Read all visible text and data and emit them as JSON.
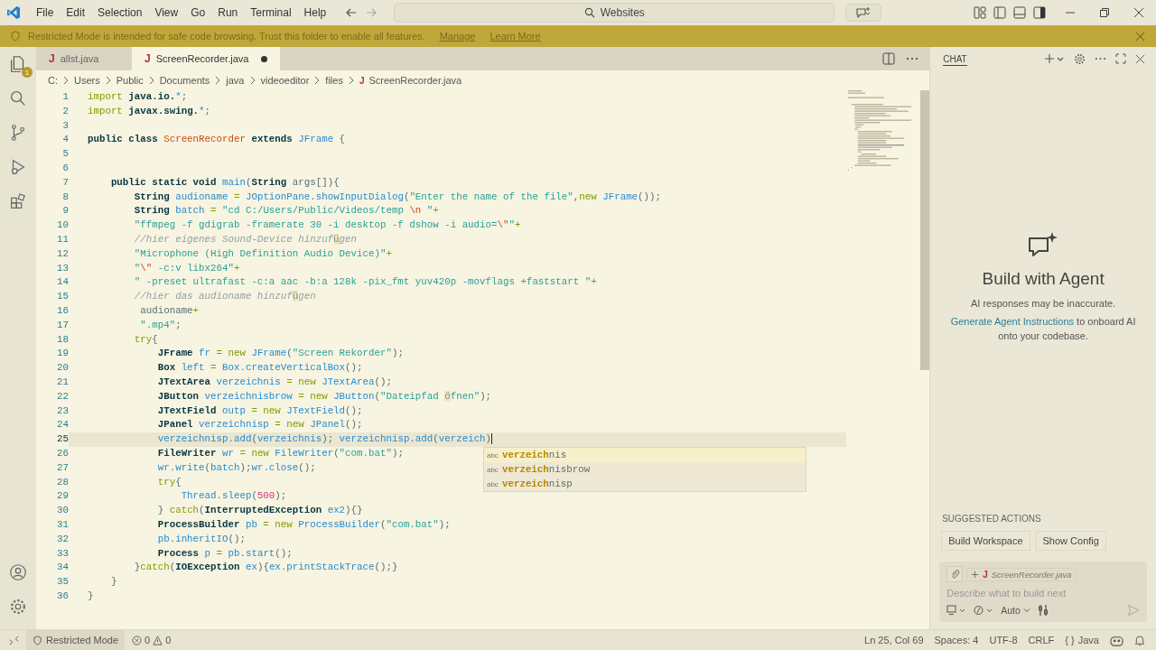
{
  "menu": [
    "File",
    "Edit",
    "Selection",
    "View",
    "Go",
    "Run",
    "Terminal",
    "Help"
  ],
  "search": {
    "value": "Websites"
  },
  "banner": {
    "text": "Restricted Mode is intended for safe code browsing. Trust this folder to enable all features.",
    "links": [
      "Manage",
      "Learn More"
    ]
  },
  "activity_bar": {
    "badge": "1"
  },
  "tabs": [
    {
      "label": "allst.java",
      "file_icon": "J",
      "selected": false,
      "modified": false
    },
    {
      "label": "ScreenRecorder.java",
      "file_icon": "J",
      "selected": true,
      "modified": true
    }
  ],
  "breadcrumb": {
    "parts": [
      "C:",
      "Users",
      "Public",
      "Documents",
      "java",
      "videoeditor",
      "files"
    ],
    "file": "ScreenRecorder.java",
    "file_icon": "J"
  },
  "code_lines": [
    {
      "number": "1",
      "current": false,
      "tokens": [
        {
          "kind": "keyword",
          "text": "import"
        },
        {
          "kind": "storage",
          "text": " java.io."
        },
        {
          "kind": "variable",
          "text": "*"
        },
        {
          "kind": "plain",
          "text": ";"
        }
      ]
    },
    {
      "number": "2",
      "current": false,
      "tokens": [
        {
          "kind": "keyword",
          "text": "import"
        },
        {
          "kind": "storage",
          "text": " javax.swing."
        },
        {
          "kind": "variable",
          "text": "*"
        },
        {
          "kind": "plain",
          "text": ";"
        }
      ]
    },
    {
      "number": "3",
      "current": false
    },
    {
      "number": "4",
      "current": false,
      "tokens": [
        {
          "kind": "storage",
          "text": "public class "
        },
        {
          "kind": "constant",
          "text": "ScreenRecorder"
        },
        {
          "kind": "storage",
          "text": " extends "
        },
        {
          "kind": "variable",
          "text": "JFrame"
        },
        {
          "kind": "plain",
          "text": " {"
        }
      ]
    },
    {
      "number": "5",
      "current": false
    },
    {
      "number": "6",
      "current": false
    },
    {
      "number": "7",
      "current": false,
      "tokens": [
        {
          "kind": "storage",
          "text": "    public static void "
        },
        {
          "kind": "variable",
          "text": "main"
        },
        {
          "kind": "plain",
          "text": "("
        },
        {
          "kind": "storage",
          "text": "String"
        },
        {
          "kind": "plain",
          "text": " args[]){"
        }
      ]
    },
    {
      "number": "8",
      "current": false,
      "tokens": [
        {
          "kind": "storage",
          "text": "        String "
        },
        {
          "kind": "variable",
          "text": "audioname"
        },
        {
          "kind": "keyword",
          "text": " = "
        },
        {
          "kind": "variable",
          "text": "JOptionPane.showInputDialog"
        },
        {
          "kind": "plain",
          "text": "("
        },
        {
          "kind": "string",
          "text": "\"Enter the name of the file\""
        },
        {
          "kind": "plain",
          "text": ","
        },
        {
          "kind": "keyword",
          "text": "new "
        },
        {
          "kind": "variable",
          "text": "JFrame"
        },
        {
          "kind": "plain",
          "text": "());"
        }
      ]
    },
    {
      "number": "9",
      "current": false,
      "tokens": [
        {
          "kind": "storage",
          "text": "        String "
        },
        {
          "kind": "variable",
          "text": "batch"
        },
        {
          "kind": "keyword",
          "text": " = "
        },
        {
          "kind": "string",
          "text": "\"cd C:/Users/Public/Videos/temp "
        },
        {
          "kind": "constant",
          "text": "\\n"
        },
        {
          "kind": "string",
          "text": " \""
        },
        {
          "kind": "keyword",
          "text": "+"
        }
      ]
    },
    {
      "number": "10",
      "current": false,
      "tokens": [
        {
          "kind": "string",
          "text": "        \"ffmpeg -f gdigrab -framerate 30 -i desktop -f dshow -i audio="
        },
        {
          "kind": "constant",
          "text": "\\\""
        },
        {
          "kind": "string",
          "text": "\""
        },
        {
          "kind": "keyword",
          "text": "+"
        }
      ]
    },
    {
      "number": "11",
      "current": false,
      "tokens": [
        {
          "kind": "comment",
          "text": "        //hier eigenes Sound-Device hinzuf"
        },
        {
          "kind": "unicode",
          "text": "ü"
        },
        {
          "kind": "comment",
          "text": "gen"
        }
      ]
    },
    {
      "number": "12",
      "current": false,
      "tokens": [
        {
          "kind": "string",
          "text": "        \"Microphone (High Definition Audio Device)\""
        },
        {
          "kind": "keyword",
          "text": "+"
        }
      ]
    },
    {
      "number": "13",
      "current": false,
      "tokens": [
        {
          "kind": "string",
          "text": "        \""
        },
        {
          "kind": "constant",
          "text": "\\\""
        },
        {
          "kind": "string",
          "text": " -c:v libx264\""
        },
        {
          "kind": "keyword",
          "text": "+"
        }
      ]
    },
    {
      "number": "14",
      "current": false,
      "tokens": [
        {
          "kind": "string",
          "text": "        \" -preset ultrafast -c:a aac -b:a 128k -pix_fmt yuv420p -movflags +faststart \""
        },
        {
          "kind": "keyword",
          "text": "+"
        }
      ]
    },
    {
      "number": "15",
      "current": false,
      "tokens": [
        {
          "kind": "comment",
          "text": "        //hier das audioname hinzuf"
        },
        {
          "kind": "unicode",
          "text": "ü"
        },
        {
          "kind": "comment",
          "text": "gen"
        }
      ]
    },
    {
      "number": "16",
      "current": false,
      "tokens": [
        {
          "kind": "plain",
          "text": "         audioname"
        },
        {
          "kind": "keyword",
          "text": "+"
        }
      ]
    },
    {
      "number": "17",
      "current": false,
      "tokens": [
        {
          "kind": "string",
          "text": "         \".mp4\""
        },
        {
          "kind": "plain",
          "text": ";"
        }
      ]
    },
    {
      "number": "18",
      "current": false,
      "tokens": [
        {
          "kind": "keyword",
          "text": "        try"
        },
        {
          "kind": "plain",
          "text": "{"
        }
      ]
    },
    {
      "number": "19",
      "current": false,
      "tokens": [
        {
          "kind": "storage",
          "text": "            JFrame "
        },
        {
          "kind": "variable",
          "text": "fr"
        },
        {
          "kind": "keyword",
          "text": " = new "
        },
        {
          "kind": "variable",
          "text": "JFrame"
        },
        {
          "kind": "plain",
          "text": "("
        },
        {
          "kind": "string",
          "text": "\"Screen Rekorder\""
        },
        {
          "kind": "plain",
          "text": ");"
        }
      ]
    },
    {
      "number": "20",
      "current": false,
      "tokens": [
        {
          "kind": "storage",
          "text": "            Box "
        },
        {
          "kind": "variable",
          "text": "left"
        },
        {
          "kind": "keyword",
          "text": " = "
        },
        {
          "kind": "variable",
          "text": "Box.createVerticalBox"
        },
        {
          "kind": "plain",
          "text": "();"
        }
      ]
    },
    {
      "number": "21",
      "current": false,
      "tokens": [
        {
          "kind": "storage",
          "text": "            JTextArea "
        },
        {
          "kind": "variable",
          "text": "verzeichnis"
        },
        {
          "kind": "keyword",
          "text": " = new "
        },
        {
          "kind": "variable",
          "text": "JTextArea"
        },
        {
          "kind": "plain",
          "text": "();"
        }
      ]
    },
    {
      "number": "22",
      "current": false,
      "tokens": [
        {
          "kind": "storage",
          "text": "            JButton "
        },
        {
          "kind": "variable",
          "text": "verzeichnisbrow"
        },
        {
          "kind": "keyword",
          "text": " = new "
        },
        {
          "kind": "variable",
          "text": "JButton"
        },
        {
          "kind": "plain",
          "text": "("
        },
        {
          "kind": "string",
          "text": "\"Dateipfad "
        },
        {
          "kind": "unicode",
          "text": "ö"
        },
        {
          "kind": "string",
          "text": "fnen\""
        },
        {
          "kind": "plain",
          "text": ");"
        }
      ]
    },
    {
      "number": "23",
      "current": false,
      "tokens": [
        {
          "kind": "storage",
          "text": "            JTextField "
        },
        {
          "kind": "variable",
          "text": "outp"
        },
        {
          "kind": "keyword",
          "text": " = new "
        },
        {
          "kind": "variable",
          "text": "JTextField"
        },
        {
          "kind": "plain",
          "text": "();"
        }
      ]
    },
    {
      "number": "24",
      "current": false,
      "tokens": [
        {
          "kind": "storage",
          "text": "            JPanel "
        },
        {
          "kind": "variable",
          "text": "verzeichnisp"
        },
        {
          "kind": "keyword",
          "text": " = new "
        },
        {
          "kind": "variable",
          "text": "JPanel"
        },
        {
          "kind": "plain",
          "text": "();"
        }
      ]
    },
    {
      "number": "25",
      "current": true,
      "tokens": [
        {
          "kind": "variable",
          "text": "            verzeichnisp.add"
        },
        {
          "kind": "plain",
          "text": "("
        },
        {
          "kind": "variable",
          "text": "verzeichnis"
        },
        {
          "kind": "plain",
          "text": "); "
        },
        {
          "kind": "variable",
          "text": "verzeichnisp.add"
        },
        {
          "kind": "plain",
          "text": "("
        },
        {
          "kind": "variable",
          "text": "verzeich"
        },
        {
          "kind": "plain",
          "text": ")"
        }
      ]
    },
    {
      "number": "26",
      "current": false,
      "tokens": [
        {
          "kind": "storage",
          "text": "            FileWriter "
        },
        {
          "kind": "variable",
          "text": "wr"
        },
        {
          "kind": "keyword",
          "text": " = new "
        },
        {
          "kind": "variable",
          "text": "FileWriter"
        },
        {
          "kind": "plain",
          "text": "("
        },
        {
          "kind": "string",
          "text": "\"com.bat\""
        },
        {
          "kind": "plain",
          "text": ");"
        }
      ]
    },
    {
      "number": "27",
      "current": false,
      "tokens": [
        {
          "kind": "variable",
          "text": "            wr.write"
        },
        {
          "kind": "plain",
          "text": "("
        },
        {
          "kind": "variable",
          "text": "batch"
        },
        {
          "kind": "plain",
          "text": ");"
        },
        {
          "kind": "variable",
          "text": "wr.close"
        },
        {
          "kind": "plain",
          "text": "();"
        }
      ]
    },
    {
      "number": "28",
      "current": false,
      "tokens": [
        {
          "kind": "keyword",
          "text": "            try"
        },
        {
          "kind": "plain",
          "text": "{"
        }
      ]
    },
    {
      "number": "29",
      "current": false,
      "tokens": [
        {
          "kind": "variable",
          "text": "                Thread.sleep"
        },
        {
          "kind": "plain",
          "text": "("
        },
        {
          "kind": "number",
          "text": "500"
        },
        {
          "kind": "plain",
          "text": ");"
        }
      ]
    },
    {
      "number": "30",
      "current": false,
      "tokens": [
        {
          "kind": "plain",
          "text": "            } "
        },
        {
          "kind": "keyword",
          "text": "catch"
        },
        {
          "kind": "plain",
          "text": "("
        },
        {
          "kind": "storage",
          "text": "InterruptedException "
        },
        {
          "kind": "variable",
          "text": "ex2"
        },
        {
          "kind": "plain",
          "text": "){}"
        }
      ]
    },
    {
      "number": "31",
      "current": false,
      "tokens": [
        {
          "kind": "storage",
          "text": "            ProcessBuilder "
        },
        {
          "kind": "variable",
          "text": "pb"
        },
        {
          "kind": "keyword",
          "text": " = new "
        },
        {
          "kind": "variable",
          "text": "ProcessBuilder"
        },
        {
          "kind": "plain",
          "text": "("
        },
        {
          "kind": "string",
          "text": "\"com.bat\""
        },
        {
          "kind": "plain",
          "text": ");"
        }
      ]
    },
    {
      "number": "32",
      "current": false,
      "tokens": [
        {
          "kind": "variable",
          "text": "            pb.inheritIO"
        },
        {
          "kind": "plain",
          "text": "();"
        }
      ]
    },
    {
      "number": "33",
      "current": false,
      "tokens": [
        {
          "kind": "storage",
          "text": "            Process "
        },
        {
          "kind": "variable",
          "text": "p"
        },
        {
          "kind": "keyword",
          "text": " = "
        },
        {
          "kind": "variable",
          "text": "pb.start"
        },
        {
          "kind": "plain",
          "text": "();"
        }
      ]
    },
    {
      "number": "34",
      "current": false,
      "tokens": [
        {
          "kind": "plain",
          "text": "        }"
        },
        {
          "kind": "keyword",
          "text": "catch"
        },
        {
          "kind": "plain",
          "text": "("
        },
        {
          "kind": "storage",
          "text": "IOException "
        },
        {
          "kind": "variable",
          "text": "ex"
        },
        {
          "kind": "plain",
          "text": "){"
        },
        {
          "kind": "variable",
          "text": "ex.printStackTrace"
        },
        {
          "kind": "plain",
          "text": "();}"
        }
      ]
    },
    {
      "number": "35",
      "current": false,
      "tokens": [
        {
          "kind": "plain",
          "text": "    }"
        }
      ]
    },
    {
      "number": "36",
      "current": false,
      "tokens": [
        {
          "kind": "plain",
          "text": "}"
        }
      ]
    }
  ],
  "suggestions": [
    {
      "icon": "abc",
      "match": "verzeich",
      "rest": "nis",
      "selected": true
    },
    {
      "icon": "abc",
      "match": "verzeich",
      "rest": "nisbrow",
      "selected": false
    },
    {
      "icon": "abc",
      "match": "verzeich",
      "rest": "nisp",
      "selected": false
    }
  ],
  "chat": {
    "tab": "CHAT",
    "title": "Build with Agent",
    "disclaimer": "AI responses may be inaccurate.",
    "link": "Generate Agent Instructions",
    "hint": " to onboard AI onto your codebase.",
    "suggested_label": "SUGGESTED ACTIONS",
    "actions": [
      "Build Workspace",
      "Show Config"
    ],
    "context_file": "ScreenRecorder.java",
    "context_icon": "J",
    "placeholder": "Describe what to build next",
    "mode": "Auto"
  },
  "status_bar": {
    "mode": "Restricted Mode",
    "errors": "0",
    "warnings": "0",
    "position": "Ln 25, Col 69",
    "indent": "Spaces: 4",
    "encoding": "UTF-8",
    "eol": "CRLF",
    "language_icon": "{ }",
    "language": "Java"
  }
}
